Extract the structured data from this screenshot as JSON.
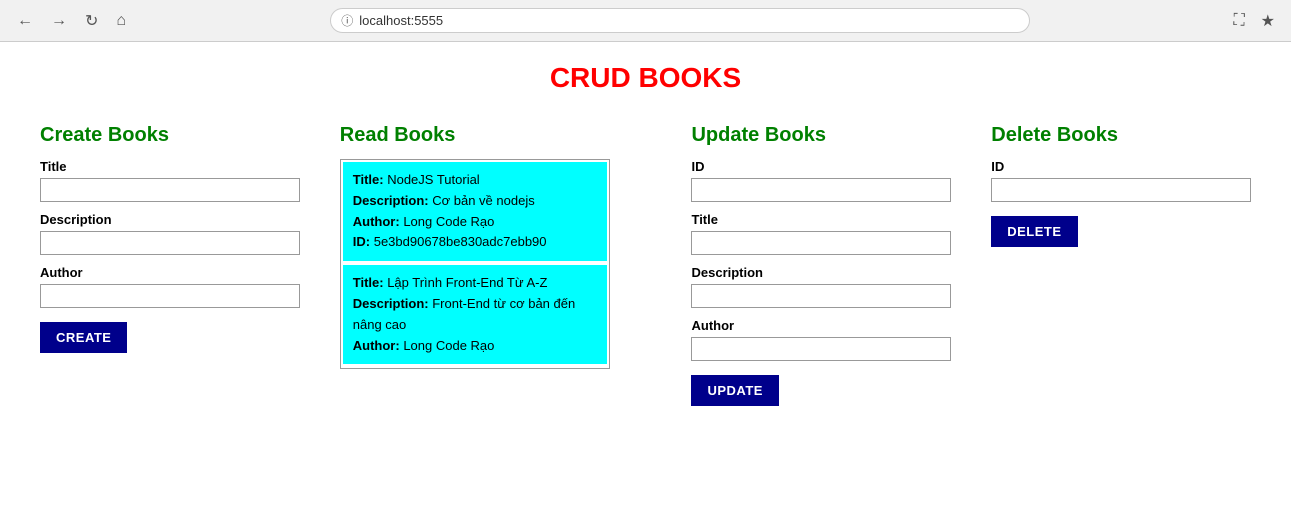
{
  "browser": {
    "url": "localhost:5555"
  },
  "page": {
    "title": "CRUD BOOKS"
  },
  "create": {
    "section_title": "Create Books",
    "title_label": "Title",
    "title_placeholder": "",
    "description_label": "Description",
    "description_placeholder": "",
    "author_label": "Author",
    "author_placeholder": "",
    "button_label": "CREATE"
  },
  "read": {
    "section_title": "Read Books",
    "books": [
      {
        "title_label": "Title:",
        "title_value": "NodeJS Tutorial",
        "description_label": "Description:",
        "description_value": "Cơ bản về nodejs",
        "author_label": "Author:",
        "author_value": "Long Code Rạo",
        "id_label": "ID:",
        "id_value": "5e3bd90678be830adc7ebb90"
      },
      {
        "title_label": "Title:",
        "title_value": "Lập Trình Front-End Từ A-Z",
        "description_label": "Description:",
        "description_value": "Front-End từ cơ bản đến nâng cao",
        "author_label": "Author:",
        "author_value": "Long Code Rạo",
        "id_label": "",
        "id_value": ""
      }
    ]
  },
  "update": {
    "section_title": "Update Books",
    "id_label": "ID",
    "title_label": "Title",
    "description_label": "Description",
    "author_label": "Author",
    "button_label": "UPDATE"
  },
  "delete": {
    "section_title": "Delete Books",
    "id_label": "ID",
    "button_label": "DELETE"
  }
}
